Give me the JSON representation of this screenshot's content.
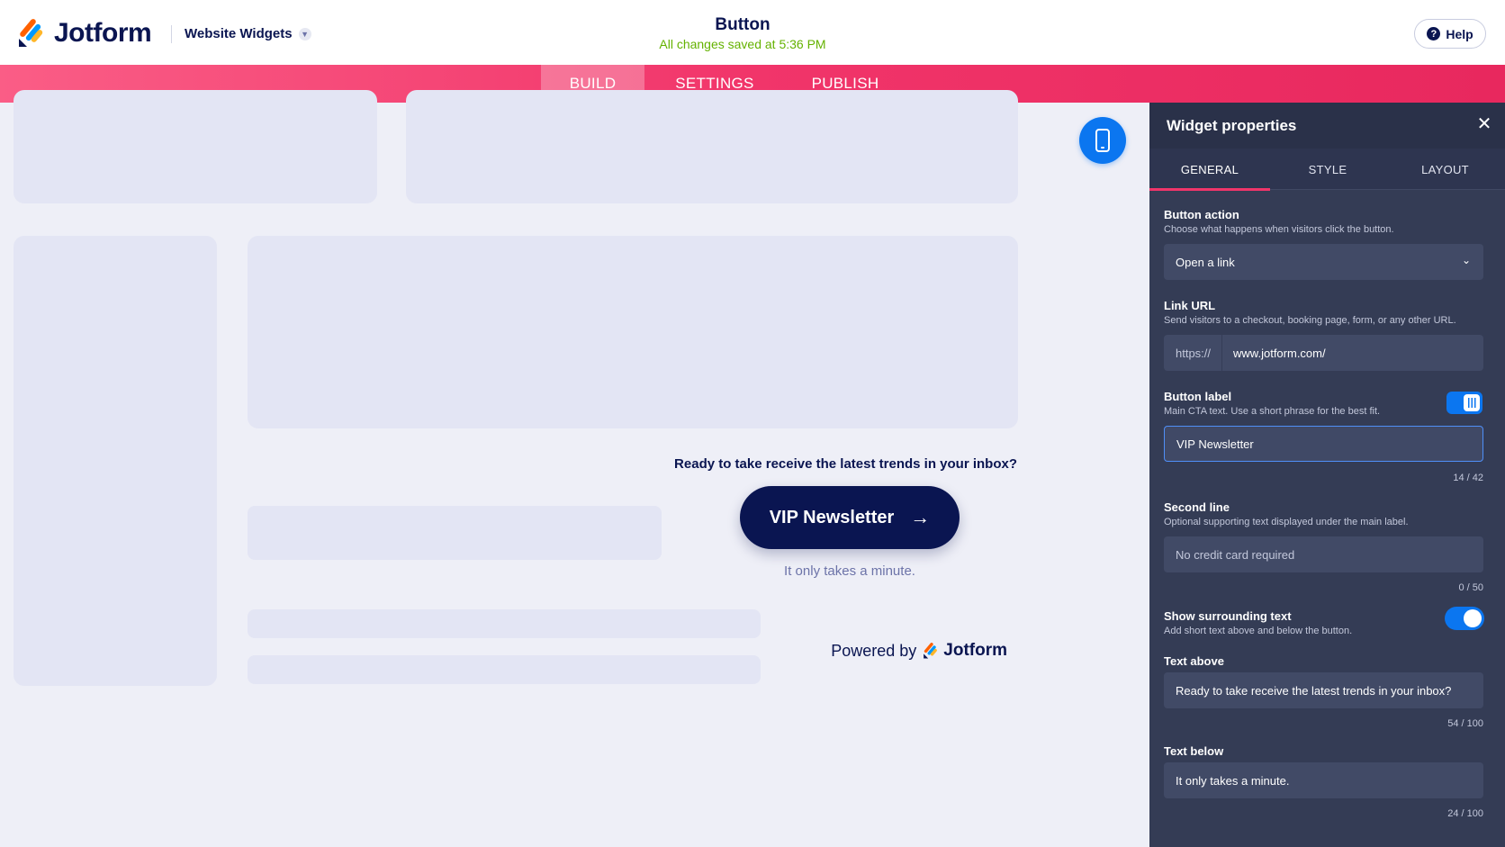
{
  "header": {
    "brand": "Jotform",
    "product_switcher": "Website Widgets",
    "title": "Button",
    "save_status": "All changes saved at 5:36 PM",
    "help_label": "Help"
  },
  "nav": {
    "tabs": [
      {
        "label": "BUILD",
        "active": true
      },
      {
        "label": "SETTINGS",
        "active": false
      },
      {
        "label": "PUBLISH",
        "active": false
      }
    ]
  },
  "preview": {
    "text_above": "Ready to take receive the latest trends in your inbox?",
    "button_label": "VIP Newsletter",
    "button_arrow": "→",
    "text_below": "It only takes a minute.",
    "powered_by": "Powered by",
    "powered_brand": "Jotform"
  },
  "panel": {
    "title": "Widget properties",
    "close": "✕",
    "tabs": [
      {
        "label": "GENERAL",
        "active": true
      },
      {
        "label": "STYLE",
        "active": false
      },
      {
        "label": "LAYOUT",
        "active": false
      }
    ],
    "button_action": {
      "label": "Button action",
      "hint": "Choose what happens when visitors click the button.",
      "value": "Open a link"
    },
    "link_url": {
      "label": "Link URL",
      "hint": "Send visitors to a checkout, booking page, form, or any other URL.",
      "prefix": "https://",
      "value": "www.jotform.com/"
    },
    "button_label": {
      "label": "Button label",
      "hint": "Main CTA text. Use a short phrase for the best fit.",
      "value": "VIP Newsletter",
      "count": "14 / 42",
      "enabled": true
    },
    "second_line": {
      "label": "Second line",
      "hint": "Optional supporting text displayed under the main label.",
      "placeholder": "No credit card required",
      "count": "0 / 50"
    },
    "show_surrounding": {
      "label": "Show surrounding text",
      "hint": "Add short text above and below the button.",
      "enabled": true
    },
    "text_above": {
      "label": "Text above",
      "value": "Ready to take receive the latest trends in your inbox?",
      "count": "54 / 100"
    },
    "text_below": {
      "label": "Text below",
      "value": "It only takes a minute.",
      "count": "24 / 100"
    }
  },
  "colors": {
    "brand_pink": "#f1356a",
    "navy": "#0a1551",
    "accent_blue": "#0b76f0",
    "save_green": "#64b200"
  },
  "icons": [
    "jotform-logo-icon",
    "chevron-down-icon",
    "help-icon",
    "mobile-preview-icon",
    "arrow-right-icon",
    "close-icon"
  ]
}
